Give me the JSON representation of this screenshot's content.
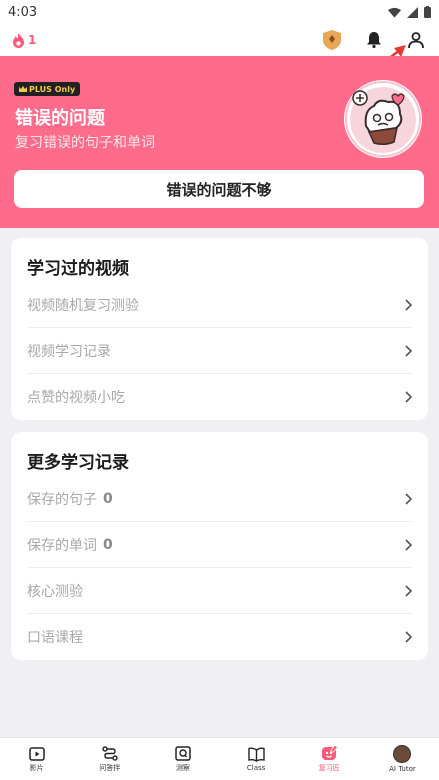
{
  "status": {
    "time": "4:03"
  },
  "top": {
    "streak_count": "1"
  },
  "hero": {
    "badge": "PLUS Only",
    "title": "错误的问题",
    "subtitle": "复习错误的句子和单词",
    "button": "错误的问题不够"
  },
  "section1": {
    "title": "学习过的视频",
    "rows": [
      {
        "label": "视频随机复习测验"
      },
      {
        "label": "视频学习记录"
      },
      {
        "label": "点赞的视频小吃"
      }
    ]
  },
  "section2": {
    "title": "更多学习记录",
    "rows": [
      {
        "label": "保存的句子",
        "value": "0"
      },
      {
        "label": "保存的单词",
        "value": "0"
      },
      {
        "label": "核心测验"
      },
      {
        "label": "口语课程"
      }
    ]
  },
  "nav": {
    "items": [
      {
        "label": "影片",
        "icon": "play-icon"
      },
      {
        "label": "问答拌",
        "icon": "route-icon"
      },
      {
        "label": "测察",
        "icon": "quiz-icon"
      },
      {
        "label": "Class",
        "icon": "book-icon"
      },
      {
        "label": "复习匠",
        "icon": "review-icon",
        "active": true
      },
      {
        "label": "AI Tutor",
        "icon": "avatar"
      }
    ]
  },
  "colors": {
    "accent": "#ff6b8a",
    "active": "#ff5a7a"
  }
}
